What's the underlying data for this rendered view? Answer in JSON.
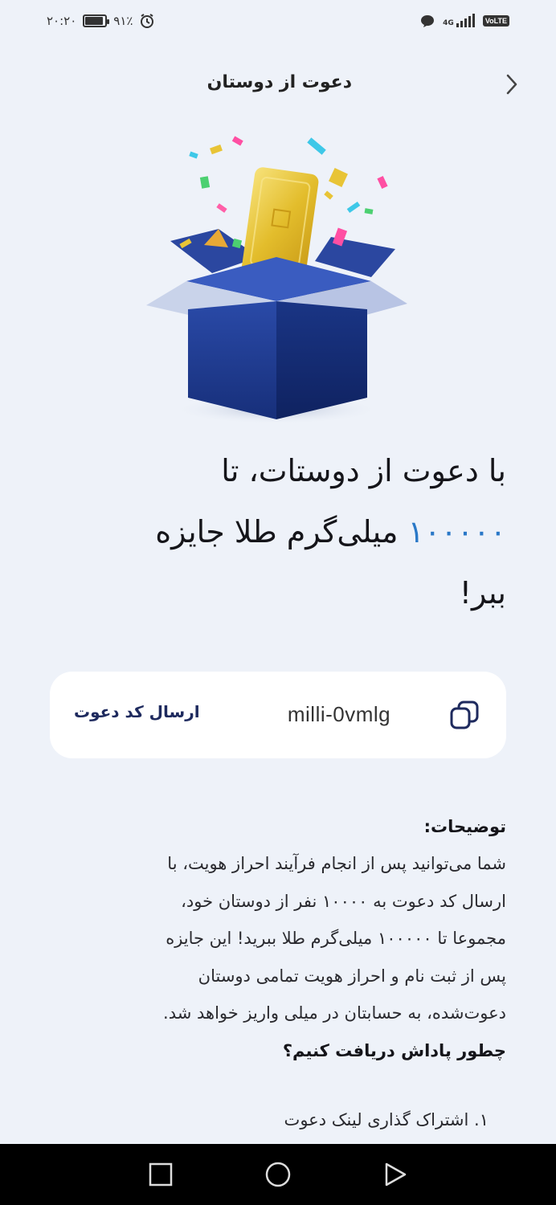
{
  "status_bar": {
    "time": "۲۰:۲۰",
    "battery": "۹۱٪",
    "battery_level": 0.91,
    "network": "4G",
    "volte": "VoLTE"
  },
  "header": {
    "title": "دعوت از دوستان",
    "back_icon": "chevron-right-icon"
  },
  "hero": {
    "image": "gift-box-with-gold-bar-illustration"
  },
  "headline": {
    "line1": "با دعوت از دوستات، تا",
    "amount": "۱۰۰۰۰۰",
    "line2_rest": " میلی‌گرم طلا جایزه",
    "line3": "ببر!"
  },
  "invite_card": {
    "send_label": "ارسال کد دعوت",
    "code": "milli-0vmlg",
    "copy_icon": "copy-icon"
  },
  "description": {
    "title": "توضیحات:",
    "lines": [
      "شما می‌توانید پس از انجام فرآیند احراز هویت، با",
      "ارسال کد دعوت به ۱۰۰۰۰ نفر از دوستان خود،",
      "مجموعا تا ۱۰۰۰۰۰ میلی‌گرم طلا ببرید! این جایزه",
      "پس از ثبت نام و احراز هویت تمامی دوستان",
      "دعوت‌شده، به حسابتان در میلی واریز خواهد شد."
    ],
    "how_title": "چطور پاداش دریافت کنیم؟",
    "steps": [
      "۱. اشتراک گذاری لینک دعوت"
    ]
  },
  "nav": {
    "recent_icon": "square-recent-apps-icon",
    "home_icon": "circle-home-icon",
    "back_icon": "triangle-back-icon"
  },
  "colors": {
    "background": "#eef2f9",
    "accent": "#2a78c7",
    "box_blue": "#1c3a8c",
    "gold": "#e8c436",
    "card": "#ffffff"
  }
}
